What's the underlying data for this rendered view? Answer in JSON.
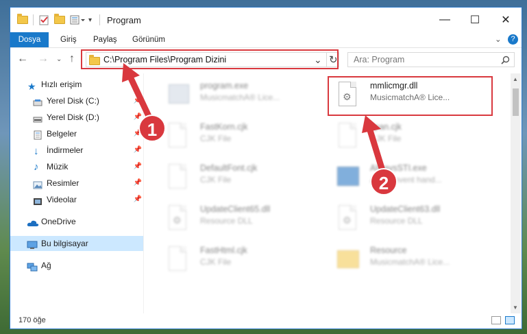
{
  "window": {
    "title": "Program",
    "minimize": "—",
    "maximize": "☐",
    "close": "✕"
  },
  "ribbon": {
    "tabs": [
      "Dosya",
      "Giriş",
      "Paylaş",
      "Görünüm"
    ],
    "expand": "⌄",
    "help": "?"
  },
  "address": {
    "path": "C:\\Program Files\\Program Dizini",
    "dropdown": "⌄",
    "refresh": "↻"
  },
  "search": {
    "placeholder": "Ara: Program"
  },
  "sidebar": {
    "items": [
      {
        "label": "Hızlı erişim"
      },
      {
        "label": "Yerel Disk (C:)"
      },
      {
        "label": "Yerel Disk (D:)"
      },
      {
        "label": "Belgeler"
      },
      {
        "label": "İndirmeler"
      },
      {
        "label": "Müzik"
      },
      {
        "label": "Resimler"
      },
      {
        "label": "Videolar"
      },
      {
        "label": "OneDrive"
      },
      {
        "label": "Bu bilgisayar"
      },
      {
        "label": "Ağ"
      }
    ]
  },
  "files": [
    {
      "name": "program.exe",
      "desc": "MusicmatchA® Lice..."
    },
    {
      "name": "mmlicmgr.dll",
      "desc": "MusicmatchA® Lice..."
    },
    {
      "name": "FastKorn.cjk",
      "desc": "CJK File"
    },
    {
      "name": "Jpan.cjk",
      "desc": "CJK File"
    },
    {
      "name": "DefaultFont.cjk",
      "desc": "CJK File"
    },
    {
      "name": "AlwaysSTI.exe",
      "desc": "A sink event hand..."
    },
    {
      "name": "UpdateClient65.dll",
      "desc": "Resource DLL"
    },
    {
      "name": "UpdateClient63.dll",
      "desc": "Resource DLL"
    },
    {
      "name": "FastHtml.cjk",
      "desc": "CJK File"
    },
    {
      "name": "Resource",
      "desc": "MusicmatchA® Lice..."
    }
  ],
  "status": {
    "count": "170 öğe"
  },
  "annotations": {
    "badge1": "1",
    "badge2": "2"
  },
  "colors": {
    "accent": "#1979ca",
    "highlight": "#d9383e",
    "selected": "#cce8ff"
  }
}
